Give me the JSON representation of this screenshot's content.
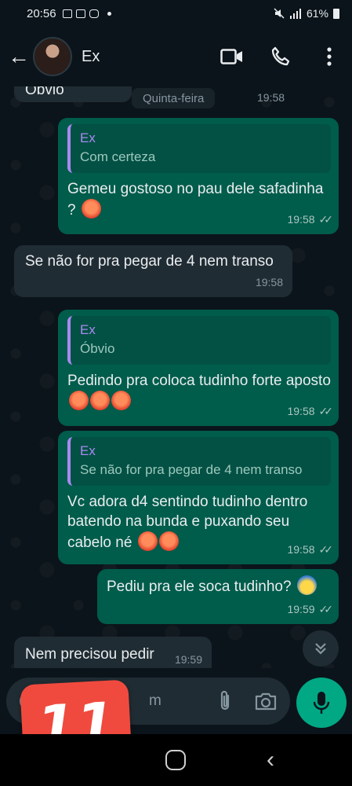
{
  "status_bar": {
    "time": "20:56",
    "battery": "61%"
  },
  "header": {
    "contact_name": "Ex"
  },
  "chat": {
    "partial_top_text": "Óbvio",
    "date_chip": "Quinta-feira",
    "date_chip_time": "19:58",
    "messages": [
      {
        "direction": "out",
        "quote_name": "Ex",
        "quote_text": "Com certeza",
        "text": "Gemeu gostoso no pau dele safadinha ?",
        "time": "19:58",
        "emoji_count": 1
      },
      {
        "direction": "in",
        "text": "Se não for pra pegar de 4 nem transo",
        "time": "19:58"
      },
      {
        "direction": "out",
        "quote_name": "Ex",
        "quote_text": "Óbvio",
        "text": "Pedindo pra coloca tudinho forte aposto",
        "time": "19:58",
        "emoji_count": 3
      },
      {
        "direction": "out",
        "quote_name": "Ex",
        "quote_text": "Se não for pra pegar de 4 nem transo",
        "text": "Vc adora d4 sentindo tudinho dentro batendo na bunda e puxando seu cabelo né",
        "time": "19:58",
        "emoji_count": 2
      },
      {
        "direction": "out",
        "text": "Pediu pra ele soca tudinho?",
        "time": "19:59",
        "emoji_count": 1
      },
      {
        "direction": "in",
        "text": "Nem precisou pedir",
        "time": "19:59"
      }
    ]
  },
  "composer": {
    "placeholder_fragment": "m"
  },
  "overlay": {
    "badge_number": "11"
  },
  "icons": {
    "back": "arrow-left-icon",
    "video": "video-call-icon",
    "call": "phone-icon",
    "menu": "more-vertical-icon",
    "attach": "paperclip-icon",
    "camera": "camera-icon",
    "mic": "microphone-icon",
    "scroll": "double-chevron-down-icon"
  },
  "colors": {
    "background": "#0b141a",
    "outgoing_bubble": "#005c4b",
    "incoming_bubble": "#202c33",
    "quote_accent": "#a98af0",
    "mic_button": "#00a884",
    "badge": "#f04a3e"
  }
}
